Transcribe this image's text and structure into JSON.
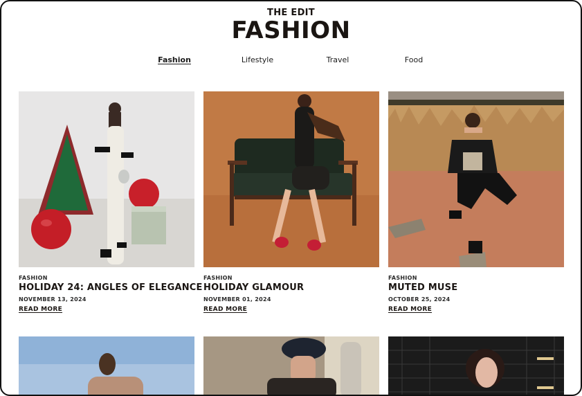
{
  "header": {
    "eyebrow": "THE EDIT",
    "title": "FASHION"
  },
  "nav": {
    "items": [
      {
        "label": "Fashion",
        "active": true
      },
      {
        "label": "Lifestyle",
        "active": false
      },
      {
        "label": "Travel",
        "active": false
      },
      {
        "label": "Food",
        "active": false
      }
    ]
  },
  "articles": [
    {
      "category": "FASHION",
      "title": "HOLIDAY 24: ANGLES OF ELEGANCE",
      "date": "NOVEMBER 13, 2024",
      "cta": "READ MORE"
    },
    {
      "category": "FASHION",
      "title": "HOLIDAY GLAMOUR",
      "date": "NOVEMBER 01, 2024",
      "cta": "READ MORE"
    },
    {
      "category": "FASHION",
      "title": "MUTED MUSE",
      "date": "OCTOBER 25, 2024",
      "cta": "READ MORE"
    }
  ],
  "colors": {
    "text": "#1a1512",
    "background": "#ffffff",
    "frame": "#111111"
  }
}
